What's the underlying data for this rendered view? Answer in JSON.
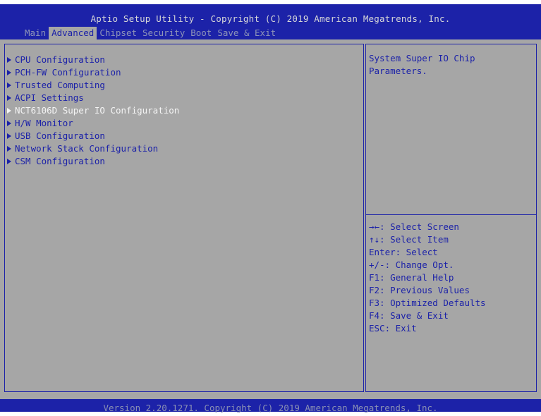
{
  "header": {
    "title": "Aptio Setup Utility - Copyright (C) 2019 American Megatrends, Inc.",
    "tabs": [
      "Main",
      "Advanced",
      "Chipset",
      "Security",
      "Boot",
      "Save & Exit"
    ],
    "active_tab": "Advanced"
  },
  "menu": {
    "items": [
      "CPU Configuration",
      "PCH-FW Configuration",
      "Trusted Computing",
      "ACPI Settings",
      "NCT6106D Super IO Configuration",
      "H/W Monitor",
      "USB Configuration",
      "Network Stack Configuration",
      "CSM Configuration"
    ],
    "selected_index": 4
  },
  "help": {
    "text": "System Super IO Chip\nParameters."
  },
  "keys": [
    "→←: Select Screen",
    "↑↓: Select Item",
    "Enter: Select",
    "+/-: Change Opt.",
    "F1: General Help",
    "F2: Previous Values",
    "F3: Optimized Defaults",
    "F4: Save & Exit",
    "ESC: Exit"
  ],
  "footer": {
    "text": "Version 2.20.1271. Copyright (C) 2019 American Megatrends, Inc."
  },
  "colors": {
    "frame_blue": "#1c22a8",
    "panel_gray": "#a6a6a6",
    "highlight_text": "#f4f4f4"
  }
}
